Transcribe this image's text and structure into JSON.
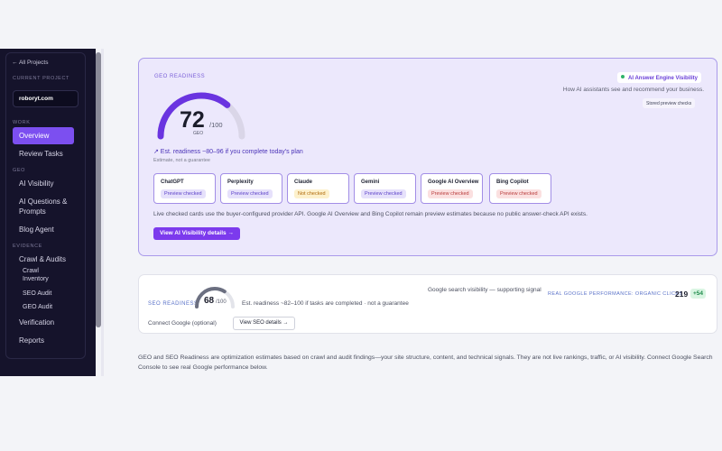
{
  "sidebar": {
    "back_link": "← All Projects",
    "current_project_label": "CURRENT PROJECT",
    "project_name": "roboryt.com",
    "sections": {
      "work": "WORK",
      "geo": "GEO",
      "evidence": "EVIDENCE"
    },
    "items": {
      "overview": "Overview",
      "review_tasks": "Review Tasks",
      "ai_visibility": "AI Visibility",
      "ai_questions_1": "AI Questions &",
      "ai_questions_2": "Prompts",
      "blog_agent": "Blog Agent",
      "crawl_audits": "Crawl & Audits",
      "crawl_inventory_1": "Crawl",
      "crawl_inventory_2": "Inventory",
      "seo_audit": "SEO Audit",
      "geo_audit": "GEO Audit",
      "verification": "Verification",
      "reports": "Reports"
    }
  },
  "geo": {
    "label": "GEO READINESS",
    "score": "72",
    "score_max": "/100",
    "score_unit": "GEO",
    "score_fraction": 0.72,
    "estimate": "↗ Est. readiness ~80–96 if you complete today's plan",
    "estimate_note": "Estimate, not a guarantee",
    "engine_badge": "AI Answer Engine Visibility",
    "engine_sub": "How AI assistants see and recommend your business.",
    "stored_badge": "Stored preview checks",
    "providers": [
      {
        "name": "ChatGPT",
        "status": "Preview checked"
      },
      {
        "name": "Perplexity",
        "status": "Preview checked"
      },
      {
        "name": "Claude",
        "status": "Not checked"
      },
      {
        "name": "Gemini",
        "status": "Preview checked"
      },
      {
        "name": "Google AI Overview",
        "status": "Preview checked"
      },
      {
        "name": "Bing Copilot",
        "status": "Preview checked"
      }
    ],
    "live_note": "Live checked cards use the buyer-configured provider API. Google AI Overview and Bing Copilot remain preview estimates because no public answer-check API exists.",
    "details_button": "View AI Visibility details →"
  },
  "seo": {
    "label": "SEO READINESS",
    "score": "68",
    "score_max": "/100",
    "score_fraction": 0.68,
    "estimate": "Est. readiness ~82–100 if tasks are completed · not a guarantee",
    "visibility_note": "Google search visibility — supporting signal",
    "clicks_label": "REAL GOOGLE PERFORMANCE: ORGANIC CLICKS",
    "clicks_value": "219",
    "clicks_delta": "+54",
    "connect_text": "Connect Google (optional)",
    "details_button": "View SEO details →"
  },
  "footer_note": "GEO and SEO Readiness are optimization estimates based on crawl and audit findings—your site structure, content, and technical signals. They are not live rankings, traffic, or AI visibility. Connect Google Search Console to see real Google performance below.",
  "colors": {
    "accent": "#7c3aed",
    "sidebar_bg": "#15132b",
    "card_bg": "#ece8fc"
  }
}
